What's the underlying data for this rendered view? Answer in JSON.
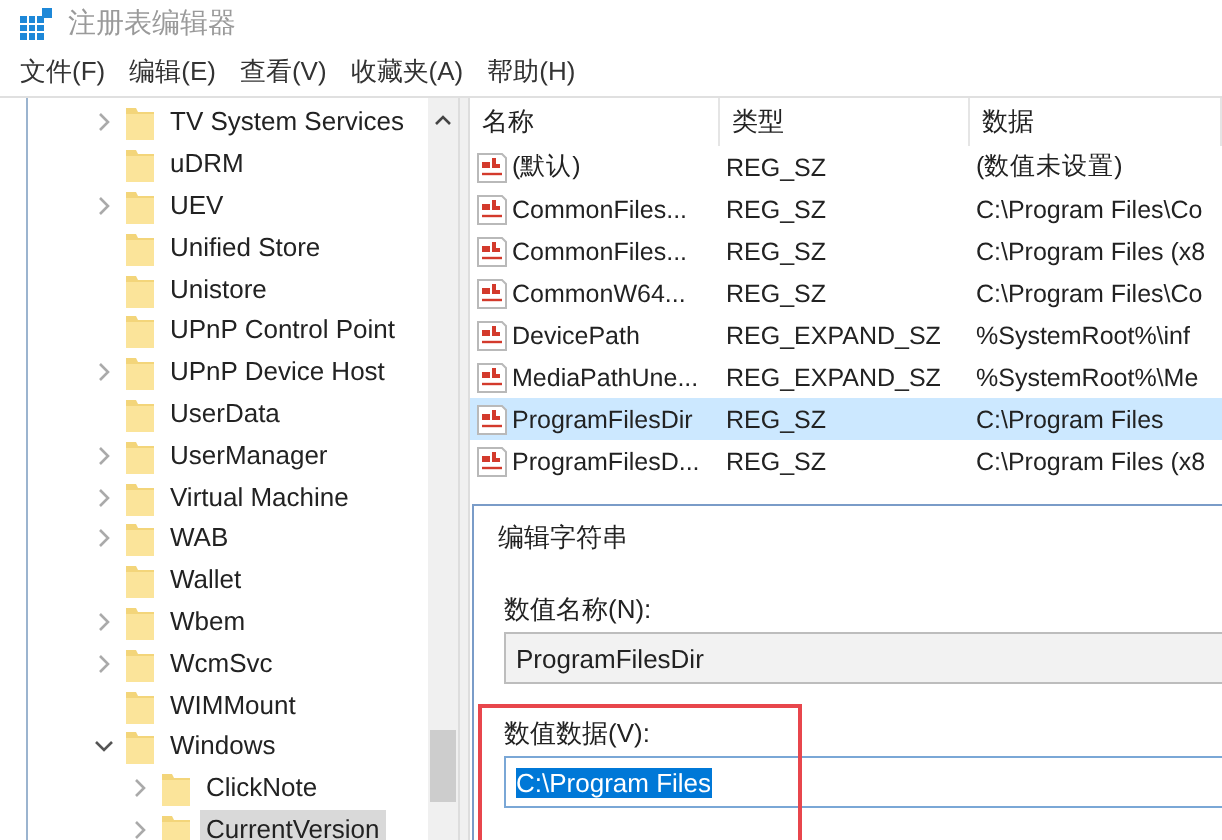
{
  "window": {
    "title": "注册表编辑器"
  },
  "menu": [
    "文件(F)",
    "编辑(E)",
    "查看(V)",
    "收藏夹(A)",
    "帮助(H)"
  ],
  "tree": [
    {
      "label": "TV System Services",
      "kind": "branch",
      "expanded": false,
      "selected": false
    },
    {
      "label": "uDRM",
      "kind": "leaf",
      "selected": false
    },
    {
      "label": "UEV",
      "kind": "branch",
      "expanded": false,
      "selected": false
    },
    {
      "label": "Unified Store",
      "kind": "leaf",
      "selected": false
    },
    {
      "label": "Unistore",
      "kind": "leaf",
      "selected": false
    },
    {
      "label": "UPnP Control Point",
      "kind": "leaf",
      "selected": false
    },
    {
      "label": "UPnP Device Host",
      "kind": "branch",
      "expanded": false,
      "selected": false
    },
    {
      "label": "UserData",
      "kind": "leaf",
      "selected": false
    },
    {
      "label": "UserManager",
      "kind": "branch",
      "expanded": false,
      "selected": false
    },
    {
      "label": "Virtual Machine",
      "kind": "branch",
      "expanded": false,
      "selected": false
    },
    {
      "label": "WAB",
      "kind": "branch",
      "expanded": false,
      "selected": false
    },
    {
      "label": "Wallet",
      "kind": "leaf",
      "selected": false
    },
    {
      "label": "Wbem",
      "kind": "branch",
      "expanded": false,
      "selected": false
    },
    {
      "label": "WcmSvc",
      "kind": "branch",
      "expanded": false,
      "selected": false
    },
    {
      "label": "WIMMount",
      "kind": "leaf",
      "selected": false
    },
    {
      "label": "Windows",
      "kind": "branch",
      "expanded": true,
      "selected": false,
      "children": [
        {
          "label": "ClickNote",
          "kind": "branch",
          "expanded": false,
          "selected": false
        },
        {
          "label": "CurrentVersion",
          "kind": "branch",
          "expanded": false,
          "selected": true
        }
      ]
    }
  ],
  "table": {
    "columns": [
      "名称",
      "类型",
      "数据"
    ],
    "rows": [
      {
        "name": "(默认)",
        "type": "REG_SZ",
        "data": "(数值未设置)",
        "selected": false
      },
      {
        "name": "CommonFiles...",
        "type": "REG_SZ",
        "data": "C:\\Program Files\\Co",
        "selected": false
      },
      {
        "name": "CommonFiles...",
        "type": "REG_SZ",
        "data": "C:\\Program Files (x8",
        "selected": false
      },
      {
        "name": "CommonW64...",
        "type": "REG_SZ",
        "data": "C:\\Program Files\\Co",
        "selected": false
      },
      {
        "name": "DevicePath",
        "type": "REG_EXPAND_SZ",
        "data": "%SystemRoot%\\inf",
        "selected": false
      },
      {
        "name": "MediaPathUne...",
        "type": "REG_EXPAND_SZ",
        "data": "%SystemRoot%\\Me",
        "selected": false
      },
      {
        "name": "ProgramFilesDir",
        "type": "REG_SZ",
        "data": "C:\\Program Files",
        "selected": true
      },
      {
        "name": "ProgramFilesD...",
        "type": "REG_SZ",
        "data": "C:\\Program Files (x8",
        "selected": false
      }
    ]
  },
  "dialog": {
    "title": "编辑字符串",
    "value_name": {
      "label": "数值名称(N):",
      "value": "ProgramFilesDir"
    },
    "value_data": {
      "label": "数值数据(V):",
      "value": "C:\\Program Files",
      "selected": true
    }
  }
}
